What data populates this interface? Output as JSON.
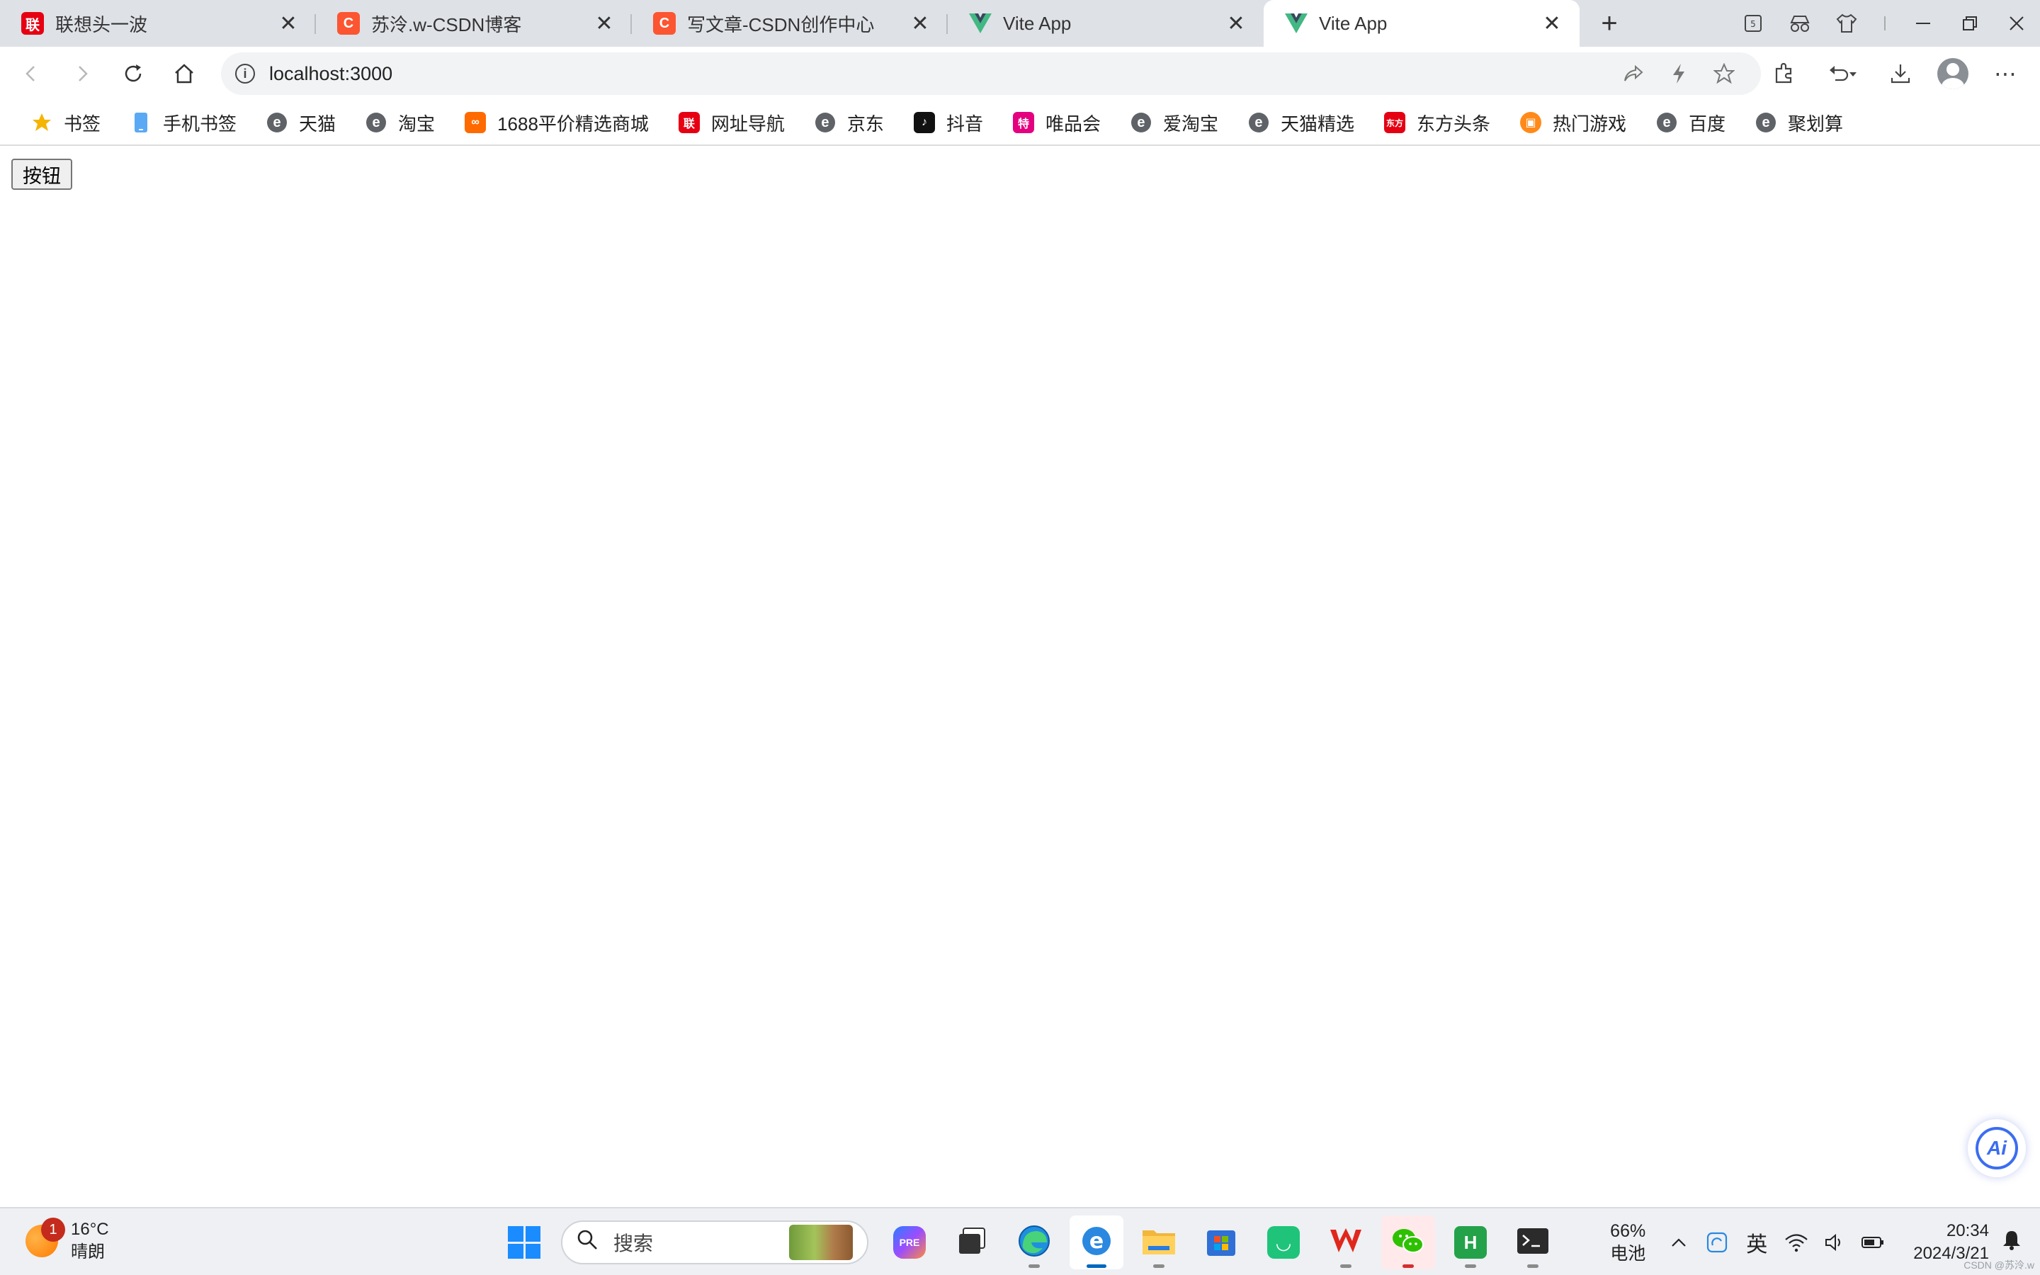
{
  "tabs": [
    {
      "title": "联想头一波",
      "favicon": "lenovo-icon",
      "color": "#e60012",
      "active": false
    },
    {
      "title": "苏泠.w-CSDN博客",
      "favicon": "csdn-icon",
      "color": "#fc5531",
      "active": false
    },
    {
      "title": "写文章-CSDN创作中心",
      "favicon": "csdn-icon",
      "color": "#fc5531",
      "active": false
    },
    {
      "title": "Vite App",
      "favicon": "vue-icon",
      "color": "#42b883",
      "active": false
    },
    {
      "title": "Vite App",
      "favicon": "vue-icon",
      "color": "#42b883",
      "active": true
    }
  ],
  "address_bar": {
    "url": "localhost:3000"
  },
  "bookmarks": [
    {
      "label": "书签",
      "icon": "star-icon"
    },
    {
      "label": "手机书签",
      "icon": "phone-icon"
    },
    {
      "label": "天猫",
      "icon": "e-icon"
    },
    {
      "label": "淘宝",
      "icon": "e-icon"
    },
    {
      "label": "1688平价精选商城",
      "icon": "1688-icon"
    },
    {
      "label": "网址导航",
      "icon": "lenovo-icon"
    },
    {
      "label": "京东",
      "icon": "e-icon"
    },
    {
      "label": "抖音",
      "icon": "douyin-icon"
    },
    {
      "label": "唯品会",
      "icon": "vip-icon"
    },
    {
      "label": "爱淘宝",
      "icon": "e-icon"
    },
    {
      "label": "天猫精选",
      "icon": "e-icon"
    },
    {
      "label": "东方头条",
      "icon": "dongfang-icon"
    },
    {
      "label": "热门游戏",
      "icon": "game-icon"
    },
    {
      "label": "百度",
      "icon": "e-icon"
    },
    {
      "label": "聚划算",
      "icon": "e-icon"
    }
  ],
  "page": {
    "button_label": "按钮"
  },
  "taskbar": {
    "weather": {
      "badge": "1",
      "temp": "16°C",
      "condition": "晴朗"
    },
    "search_placeholder": "搜索",
    "battery": {
      "percent": "66%",
      "label": "电池"
    },
    "ime": "英",
    "clock": {
      "time": "20:34",
      "date": "2024/3/21"
    }
  },
  "watermark": "CSDN @苏泠.w",
  "colors": {
    "accent": "#0067c0",
    "tabstrip": "#dee1e6"
  }
}
